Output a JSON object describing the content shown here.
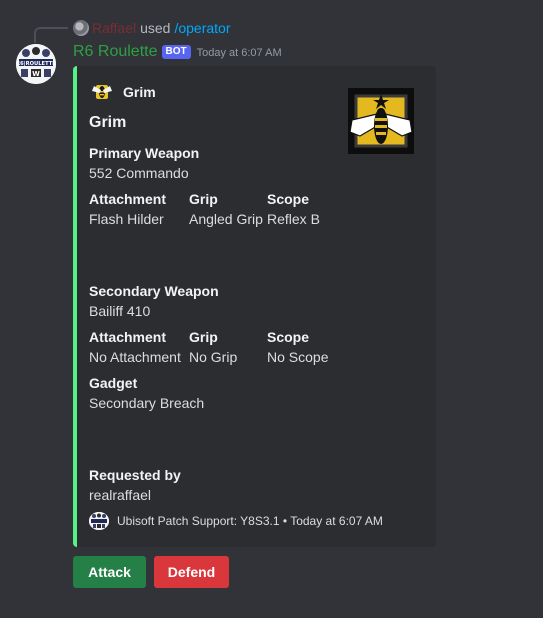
{
  "reply": {
    "user": "Raffael",
    "used": "used",
    "command": "/operator"
  },
  "header": {
    "bot_name": "R6 Roulette",
    "bot_tag": "BOT",
    "timestamp": "Today at 6:07 AM"
  },
  "avatar": {
    "text_top": "R6 ROULETTE"
  },
  "embed": {
    "accent_color": "#57f287",
    "author": "Grim",
    "title": "Grim",
    "primary_weapon_label": "Primary Weapon",
    "primary_weapon": "552 Commando",
    "primary_attachments": [
      {
        "label": "Attachment",
        "value": "Flash Hilder"
      },
      {
        "label": "Grip",
        "value": "Angled Grip"
      },
      {
        "label": "Scope",
        "value": "Reflex B"
      }
    ],
    "secondary_weapon_label": "Secondary Weapon",
    "secondary_weapon": "Bailiff 410",
    "secondary_attachments": [
      {
        "label": "Attachment",
        "value": "No Attachment"
      },
      {
        "label": "Grip",
        "value": "No Grip"
      },
      {
        "label": "Scope",
        "value": "No Scope"
      }
    ],
    "gadget_label": "Gadget",
    "gadget": "Secondary Breach",
    "requested_by_label": "Requested by",
    "requested_by": "realraffael",
    "footer": "Ubisoft Patch Support: Y8S3.1 • Today at 6:07 AM"
  },
  "buttons": {
    "attack": "Attack",
    "defend": "Defend",
    "attack_color": "#248046",
    "defend_color": "#da373c"
  }
}
